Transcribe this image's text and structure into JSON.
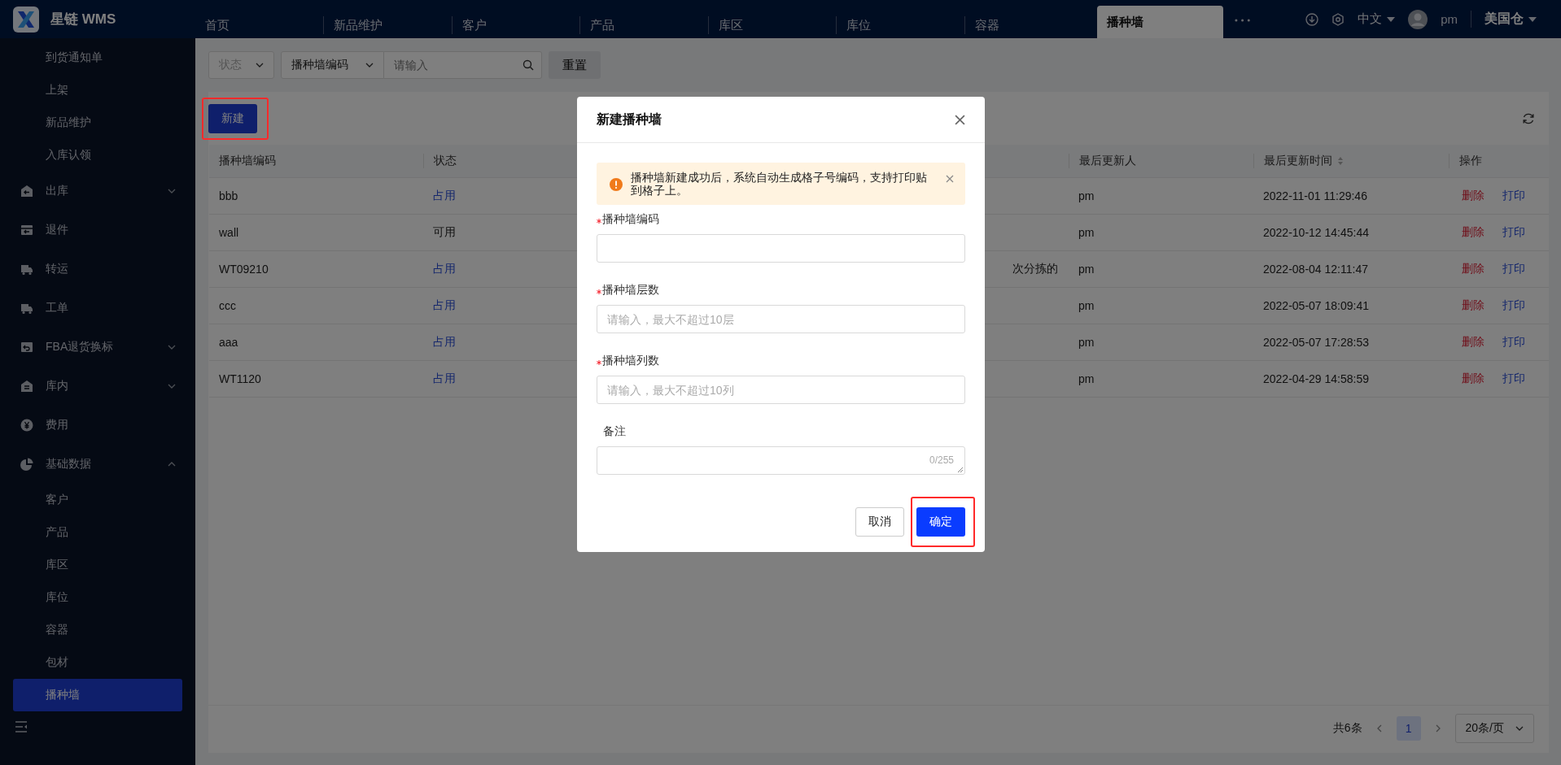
{
  "app": {
    "name": "星链 WMS"
  },
  "top_tabs": [
    {
      "label": "首页",
      "selected": false
    },
    {
      "label": "新品维护",
      "selected": false
    },
    {
      "label": "客户",
      "selected": false
    },
    {
      "label": "产品",
      "selected": false
    },
    {
      "label": "库区",
      "selected": false
    },
    {
      "label": "库位",
      "selected": false
    },
    {
      "label": "容器",
      "selected": false
    },
    {
      "label": "播种墙",
      "selected": true
    }
  ],
  "header": {
    "language": "中文",
    "user": "pm",
    "warehouse": "美国仓"
  },
  "sidebar": {
    "items": [
      {
        "label": "到货通知单",
        "kind": "sub",
        "selected": false
      },
      {
        "label": "上架",
        "kind": "sub",
        "selected": false
      },
      {
        "label": "新品维护",
        "kind": "sub",
        "selected": false
      },
      {
        "label": "入库认领",
        "kind": "sub",
        "selected": false
      },
      {
        "label": "出库",
        "kind": "group",
        "expanded": false,
        "selected": false
      },
      {
        "label": "退件",
        "kind": "group",
        "selected": false
      },
      {
        "label": "转运",
        "kind": "group",
        "selected": false
      },
      {
        "label": "工单",
        "kind": "group",
        "selected": false
      },
      {
        "label": "FBA退货换标",
        "kind": "group",
        "expanded": false,
        "selected": false
      },
      {
        "label": "库内",
        "kind": "group",
        "expanded": false,
        "selected": false
      },
      {
        "label": "费用",
        "kind": "group",
        "selected": false
      },
      {
        "label": "基础数据",
        "kind": "group",
        "expanded": true,
        "selected": false,
        "children": [
          {
            "label": "客户",
            "selected": false
          },
          {
            "label": "产品",
            "selected": false
          },
          {
            "label": "库区",
            "selected": false
          },
          {
            "label": "库位",
            "selected": false
          },
          {
            "label": "容器",
            "selected": false
          },
          {
            "label": "包材",
            "selected": false
          },
          {
            "label": "播种墙",
            "selected": true
          }
        ]
      }
    ]
  },
  "filters": {
    "status": {
      "placeholder": "状态"
    },
    "field": {
      "value": "播种墙编码"
    },
    "search": {
      "placeholder": "请输入"
    },
    "reset": "重置"
  },
  "toolbar": {
    "new_button": {
      "label": "新建",
      "highlighted": true
    }
  },
  "table": {
    "columns": [
      {
        "label": "播种墙编码"
      },
      {
        "label": "状态"
      },
      {
        "label": "最后更新人"
      },
      {
        "label": "最后更新时间",
        "sortable": true
      },
      {
        "label": "操作"
      }
    ],
    "rows": [
      {
        "code": "bbb",
        "status": "占用",
        "kind": "occupied",
        "updater": "pm",
        "updated": "2022-11-01 11:29:46",
        "actions": [
          "删除",
          "打印"
        ]
      },
      {
        "code": "wall",
        "status": "可用",
        "kind": "free",
        "updater": "pm",
        "updated": "2022-10-12 14:45:44",
        "actions": [
          "删除",
          "打印"
        ]
      },
      {
        "code": "WT09210",
        "status": "占用",
        "kind": "occupied",
        "column_3": "次分拣的",
        "updater": "pm",
        "updated": "2022-08-04 12:11:47",
        "actions": [
          "删除",
          "打印"
        ]
      },
      {
        "code": "ccc",
        "status": "占用",
        "kind": "occupied",
        "updater": "pm",
        "updated": "2022-05-07 18:09:41",
        "actions": [
          "删除",
          "打印"
        ]
      },
      {
        "code": "aaa",
        "status": "占用",
        "kind": "occupied",
        "updater": "pm",
        "updated": "2022-05-07 17:28:53",
        "actions": [
          "删除",
          "打印"
        ]
      },
      {
        "code": "WT1120",
        "status": "占用",
        "kind": "occupied",
        "updater": "pm",
        "updated": "2022-04-29 14:58:59",
        "actions": [
          "删除",
          "打印"
        ]
      }
    ]
  },
  "pagination": {
    "total": "共6条",
    "pages": [
      {
        "label": "1",
        "selected": true
      }
    ],
    "page_size": "20条/页"
  },
  "dialog": {
    "title": "新建播种墙",
    "alert": "播种墙新建成功后，系统自动生成格子号编码，支持打印贴到格子上。",
    "fields": [
      {
        "label": "播种墙编码",
        "required": true,
        "kind": "input"
      },
      {
        "label": "播种墙层数",
        "required": true,
        "kind": "input",
        "placeholder": "请输入，最大不超过10层"
      },
      {
        "label": "播种墙列数",
        "required": true,
        "kind": "input",
        "placeholder": "请输入，最大不超过10列"
      },
      {
        "label": "备注",
        "required": false,
        "kind": "textarea",
        "counter": "0/255"
      }
    ],
    "buttons": [
      {
        "label": "取消",
        "kind": "secondary"
      },
      {
        "label": "确定",
        "kind": "primary",
        "highlighted": true
      }
    ]
  }
}
